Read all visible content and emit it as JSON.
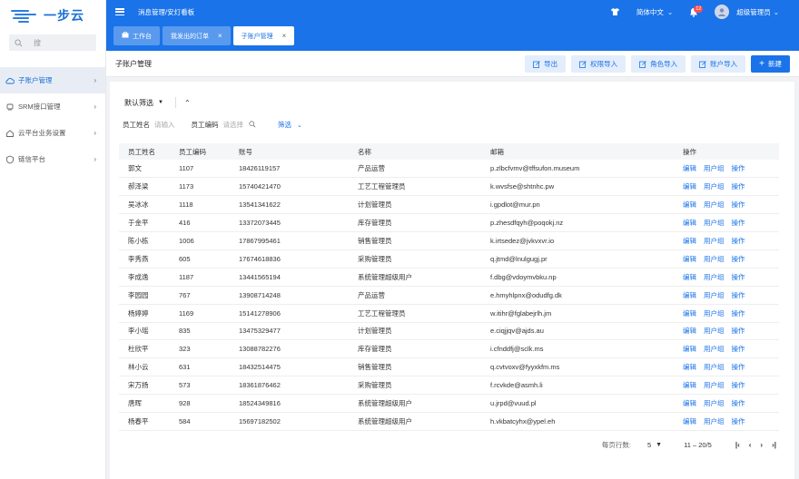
{
  "brand": {
    "name": "一步云",
    "color": "#1a73e8"
  },
  "sidebar": {
    "search_placeholder": "搜",
    "items": [
      {
        "label": "子账户管理",
        "icon": "cloud-icon",
        "active": true
      },
      {
        "label": "SRM接口管理",
        "icon": "plug-icon",
        "active": false
      },
      {
        "label": "云平台业务设置",
        "icon": "home-icon",
        "active": false
      },
      {
        "label": "链信平台",
        "icon": "shield-icon",
        "active": false
      }
    ]
  },
  "topbar": {
    "breadcrumb": "消息管理/安灯看板",
    "theme_icon": "shirt-icon",
    "language": "简体中文",
    "notification_count": "12",
    "user": "超级管理员"
  },
  "tabs": [
    {
      "label": "工作台",
      "closable": false
    },
    {
      "label": "我发出的订单",
      "closable": true
    },
    {
      "label": "子账户管理",
      "closable": true,
      "active": true
    }
  ],
  "page": {
    "title": "子账户管理",
    "actions": [
      "导出",
      "权限导入",
      "角色导入",
      "账户导入"
    ],
    "new_label": "新建"
  },
  "filters": {
    "preset": "默认筛选",
    "name_label": "员工姓名",
    "name_placeholder": "请输入",
    "code_label": "员工编码",
    "code_placeholder": "请选择",
    "filter_label": "筛选"
  },
  "table": {
    "columns": [
      "员工姓名",
      "员工编码",
      "账号",
      "名称",
      "邮箱",
      "操作"
    ],
    "op_labels": [
      "编辑",
      "用户组",
      "操作"
    ],
    "rows": [
      [
        "郭文",
        "1107",
        "18426119157",
        "产品运营",
        "p.zlbcfvmv@tffsufon.museum"
      ],
      [
        "郝泽梁",
        "1173",
        "15740421470",
        "工艺工程管理员",
        "k.wvsfse@shtnhc.pw"
      ],
      [
        "吴冰冰",
        "1118",
        "13541341622",
        "计划管理员",
        "i.gpdlot@mur.pn"
      ],
      [
        "于金平",
        "416",
        "13372073445",
        "库存管理员",
        "p.zhesdfqyh@poqokj.nz"
      ],
      [
        "陈小栋",
        "1006",
        "17867995461",
        "销售管理员",
        "k.irtsedez@jvkvxvr.io"
      ],
      [
        "李秀燕",
        "605",
        "17674618836",
        "采购管理员",
        "q.jtmd@lnulgugj.pr"
      ],
      [
        "李成逸",
        "1187",
        "13441565194",
        "系统管理超级用户",
        "f.dbg@vdoymvbku.np"
      ],
      [
        "李园园",
        "767",
        "13908714248",
        "产品运营",
        "e.hmyhlpnx@odudfg.dk"
      ],
      [
        "杨婷婷",
        "1169",
        "15141278906",
        "工艺工程管理员",
        "w.itihr@fglabejrlh.jm"
      ],
      [
        "李小瑶",
        "835",
        "13475329477",
        "计划管理员",
        "e.ciqjjqv@ajds.au"
      ],
      [
        "杜欣平",
        "323",
        "13088782276",
        "库存管理员",
        "i.cfnddfj@sclk.ms"
      ],
      [
        "林小云",
        "631",
        "18432514475",
        "销售管理员",
        "q.cvtvoxv@fyyxkfm.ms"
      ],
      [
        "宋万扬",
        "573",
        "18361876462",
        "采购管理员",
        "f.rcvkde@asmh.li"
      ],
      [
        "唐晖",
        "928",
        "18524349816",
        "系统管理超级用户",
        "u.jrpd@vuud.pl"
      ],
      [
        "杨春平",
        "584",
        "15697182502",
        "系统管理超级用户",
        "h.vkbatcyhx@ypel.eh"
      ]
    ]
  },
  "pagination": {
    "rows_label": "每页行数:",
    "page_size": "5",
    "range": "11 – 20/5"
  }
}
